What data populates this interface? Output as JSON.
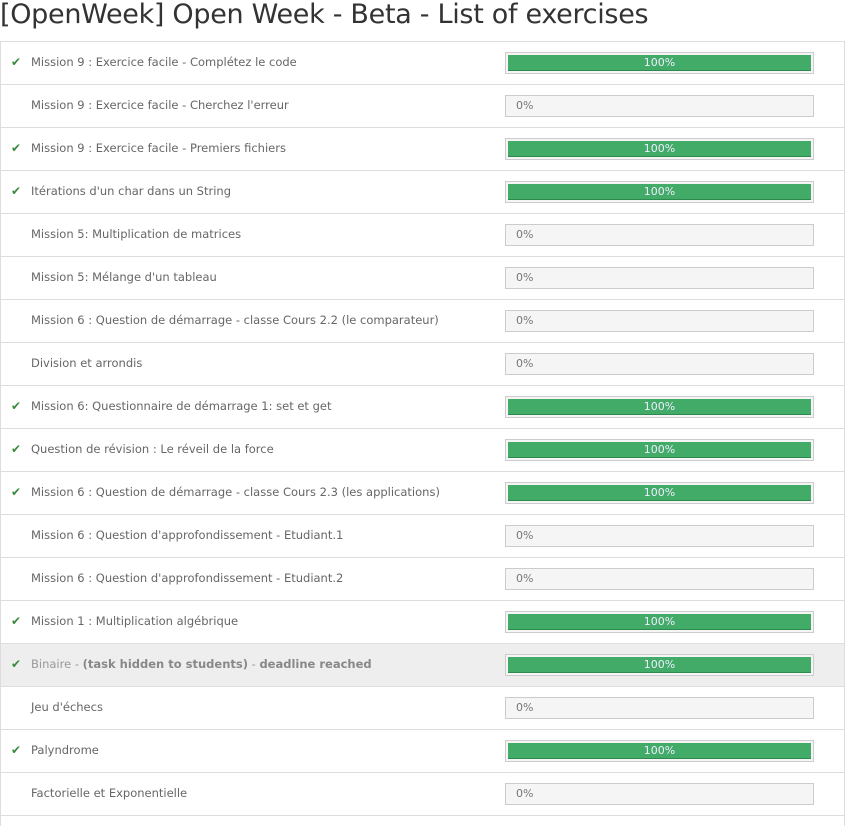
{
  "title": "[OpenWeek] Open Week - Beta - List of exercises",
  "colors": {
    "success": "#43ab68",
    "check": "#3a8a3a"
  },
  "exercises": [
    {
      "name": "Mission 9 : Exercice facile - Complétez le code",
      "done": true,
      "progress": 100,
      "progress_label": "100%"
    },
    {
      "name": "Mission 9 : Exercice facile - Cherchez l'erreur",
      "done": false,
      "progress": 0,
      "progress_label": "0%"
    },
    {
      "name": "Mission 9 : Exercice facile - Premiers fichiers",
      "done": true,
      "progress": 100,
      "progress_label": "100%"
    },
    {
      "name": "Itérations d'un char dans un String",
      "done": true,
      "progress": 100,
      "progress_label": "100%"
    },
    {
      "name": "Mission 5: Multiplication de matrices",
      "done": false,
      "progress": 0,
      "progress_label": "0%"
    },
    {
      "name": "Mission 5: Mélange d'un tableau",
      "done": false,
      "progress": 0,
      "progress_label": "0%"
    },
    {
      "name": "Mission 6 : Question de démarrage - classe Cours 2.2 (le comparateur)",
      "done": false,
      "progress": 0,
      "progress_label": "0%"
    },
    {
      "name": "Division et arrondis",
      "done": false,
      "progress": 0,
      "progress_label": "0%"
    },
    {
      "name": "Mission 6: Questionnaire de démarrage 1: set et get",
      "done": true,
      "progress": 100,
      "progress_label": "100%"
    },
    {
      "name": "Question de révision : Le réveil de la force",
      "done": true,
      "progress": 100,
      "progress_label": "100%"
    },
    {
      "name": "Mission 6 : Question de démarrage - classe Cours 2.3 (les applications)",
      "done": true,
      "progress": 100,
      "progress_label": "100%"
    },
    {
      "name": "Mission 6 : Question d'approfondissement - Etudiant.1",
      "done": false,
      "progress": 0,
      "progress_label": "0%"
    },
    {
      "name": "Mission 6 : Question d'approfondissement - Etudiant.2",
      "done": false,
      "progress": 0,
      "progress_label": "0%"
    },
    {
      "name": "Mission 1 : Multiplication algébrique",
      "done": true,
      "progress": 100,
      "progress_label": "100%"
    },
    {
      "name": "Binaire",
      "hidden_note": "(task hidden to students)",
      "deadline_note": "deadline reached",
      "separator": " - ",
      "hidden": true,
      "done": true,
      "progress": 100,
      "progress_label": "100%"
    },
    {
      "name": "Jeu d'échecs",
      "done": false,
      "progress": 0,
      "progress_label": "0%"
    },
    {
      "name": "Palyndrome",
      "done": true,
      "progress": 100,
      "progress_label": "100%"
    },
    {
      "name": "Factorielle et Exponentielle",
      "done": false,
      "progress": 0,
      "progress_label": "0%"
    }
  ]
}
